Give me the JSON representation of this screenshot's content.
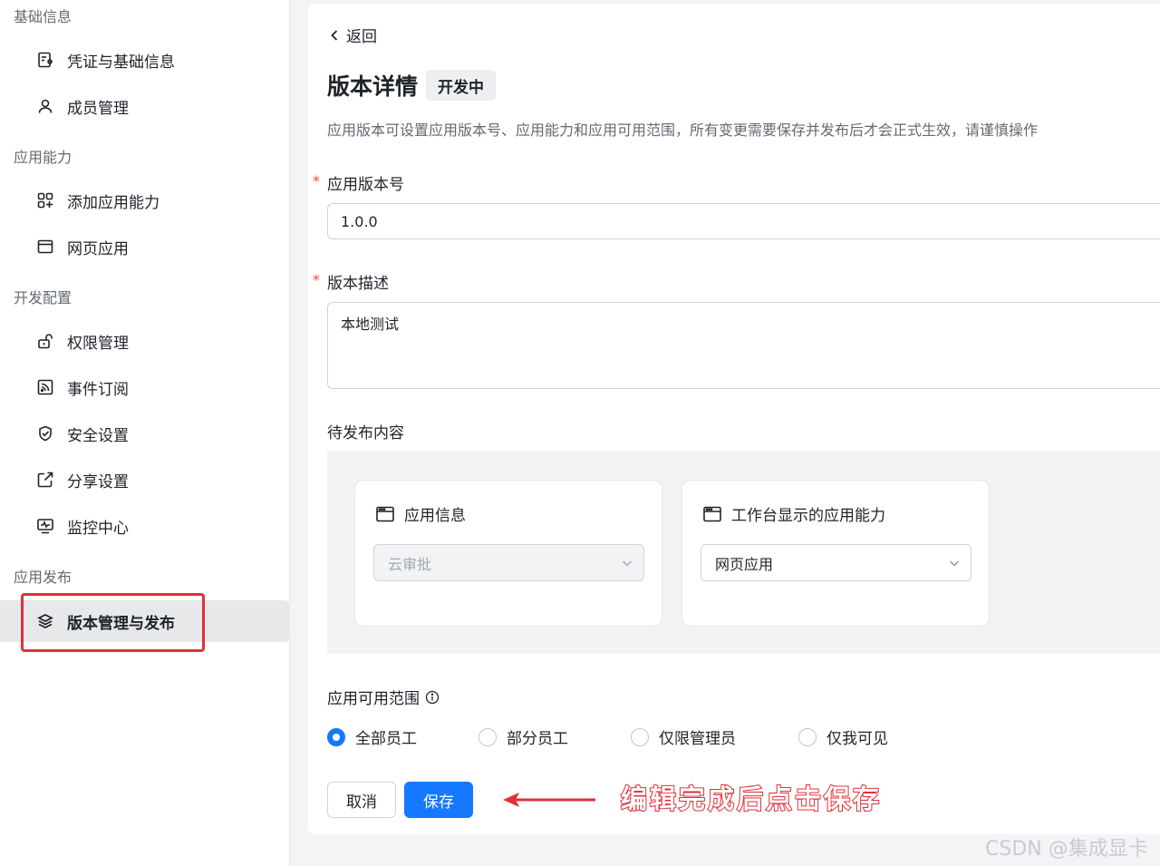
{
  "sidebar": {
    "groups": [
      {
        "title": "基础信息"
      },
      {
        "title": "应用能力"
      },
      {
        "title": "开发配置"
      },
      {
        "title": "应用发布"
      }
    ],
    "items": [
      {
        "label": "凭证与基础信息",
        "icon": "credential-icon"
      },
      {
        "label": "成员管理",
        "icon": "user-icon"
      },
      {
        "label": "添加应用能力",
        "icon": "add-app-icon"
      },
      {
        "label": "网页应用",
        "icon": "browser-window-icon"
      },
      {
        "label": "权限管理",
        "icon": "lock-icon"
      },
      {
        "label": "事件订阅",
        "icon": "rss-icon"
      },
      {
        "label": "安全设置",
        "icon": "shield-icon"
      },
      {
        "label": "分享设置",
        "icon": "share-icon"
      },
      {
        "label": "监控中心",
        "icon": "monitor-icon"
      },
      {
        "label": "版本管理与发布",
        "icon": "layers-icon"
      }
    ],
    "active_item": "版本管理与发布"
  },
  "main": {
    "back_label": "返回",
    "title": "版本详情",
    "status": "开发中",
    "description": "应用版本可设置应用版本号、应用能力和应用可用范围，所有变更需要保存并发布后才会正式生效，请谨慎操作",
    "version_field": {
      "label": "应用版本号",
      "required_mark": "*",
      "value": "1.0.0"
    },
    "desc_field": {
      "label": "版本描述",
      "required_mark": "*",
      "value": "本地测试"
    },
    "pending": {
      "label": "待发布内容",
      "cards": [
        {
          "title": "应用信息",
          "select_value": "云审批",
          "disabled": true
        },
        {
          "title": "工作台显示的应用能力",
          "select_value": "网页应用",
          "disabled": false
        }
      ]
    },
    "scope": {
      "label": "应用可用范围",
      "info_icon": "info-circle-icon",
      "options": [
        "全部员工",
        "部分员工",
        "仅限管理员",
        "仅我可见"
      ],
      "selected": "全部员工"
    },
    "buttons": {
      "cancel": "取消",
      "save": "保存"
    }
  },
  "annotation": {
    "text": "编辑完成后点击保存",
    "color": "#e0303a"
  },
  "watermark": "CSDN @集成显卡",
  "colors": {
    "primary": "#1677ff",
    "highlight_red": "#e0303a",
    "required_red": "#f54a45"
  }
}
